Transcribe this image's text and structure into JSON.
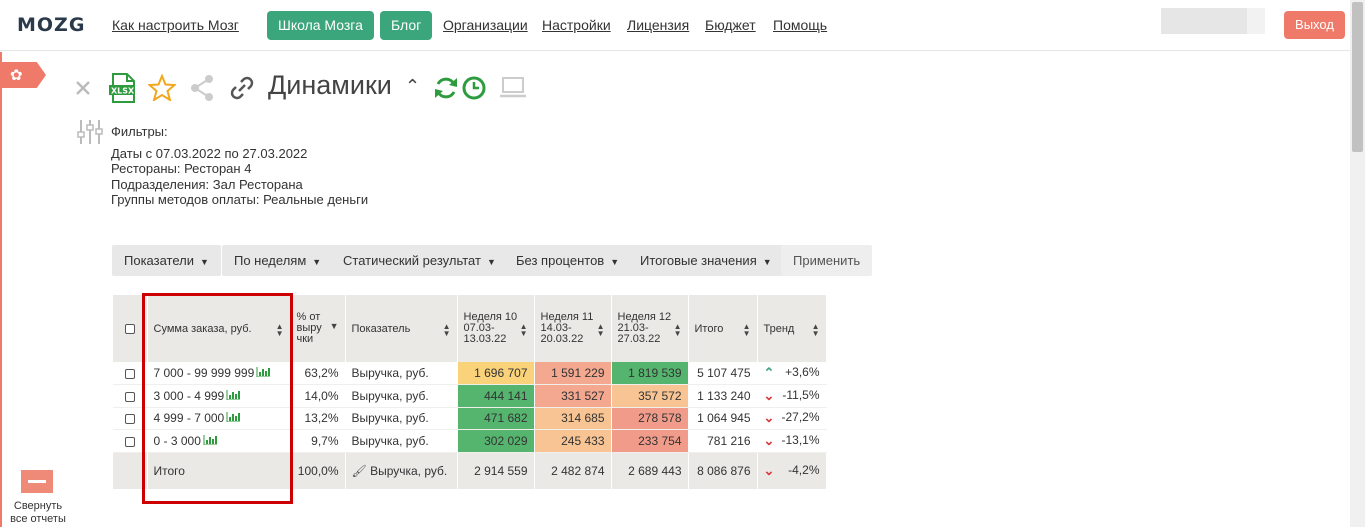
{
  "nav": {
    "logo": "MOZG",
    "links": [
      "Как настроить Мозг",
      "Организации",
      "Настройки",
      "Лицензия",
      "Бюджет",
      "Помощь"
    ],
    "school_btn": "Школа Мозга",
    "blog_btn": "Блог",
    "logout": "Выход"
  },
  "sidebar": {
    "collapse_label": "Свернуть все отчеты"
  },
  "report": {
    "title": "Динамики"
  },
  "filters": {
    "heading": "Фильтры:",
    "dates_label": "Даты",
    "dates_value": " с 07.03.2022 по 27.03.2022",
    "restaurants_label": "Рестораны:",
    "restaurants_value": " Ресторан 4",
    "departments_label": "Подразделения:",
    "departments_value": " Зал Ресторана",
    "payment_label": "Группы методов оплаты:",
    "payment_value": " Реальные деньги"
  },
  "toolbar": {
    "indicators": "Показатели",
    "by_weeks": "По неделям",
    "static_result": "Статический результат",
    "no_percent": "Без процентов",
    "totals": "Итоговые значения",
    "apply": "Применить"
  },
  "table": {
    "headers": {
      "order_sum": "Сумма заказа, руб.",
      "percent": "% от выру чки",
      "indicator": "Показатель",
      "week10": "Неделя 10 07.03-13.03.22",
      "week11": "Неделя 11 14.03-20.03.22",
      "week12": "Неделя 12 21.03-27.03.22",
      "total": "Итого",
      "trend": "Тренд"
    },
    "rows": [
      {
        "range": "7 000 - 99 999 999",
        "pct": "63,2%",
        "indicator": "Выручка, руб.",
        "w10": "1 696 707",
        "w11": "1 591 229",
        "w12": "1 819 539",
        "total": "5 107 475",
        "trend_dir": "up",
        "trend": "+3,6%"
      },
      {
        "range": "3 000 - 4 999",
        "pct": "14,0%",
        "indicator": "Выручка, руб.",
        "w10": "444 141",
        "w11": "331 527",
        "w12": "357 572",
        "total": "1 133 240",
        "trend_dir": "down",
        "trend": "-11,5%"
      },
      {
        "range": "4 999 - 7 000",
        "pct": "13,2%",
        "indicator": "Выручка, руб.",
        "w10": "471 682",
        "w11": "314 685",
        "w12": "278 578",
        "total": "1 064 945",
        "trend_dir": "down",
        "trend": "-27,2%"
      },
      {
        "range": "0 - 3 000",
        "pct": "9,7%",
        "indicator": "Выручка, руб.",
        "w10": "302 029",
        "w11": "245 433",
        "w12": "233 754",
        "total": "781 216",
        "trend_dir": "down",
        "trend": "-13,1%"
      }
    ],
    "total_row": {
      "label": "Итого",
      "pct": "100,0%",
      "indicator": "Выручка, руб.",
      "w10": "2 914 559",
      "w11": "2 482 874",
      "w12": "2 689 443",
      "total": "8 086 876",
      "trend": "-4,2%"
    }
  },
  "colors": {
    "green": "#55b56e",
    "light_red": "#f3a88f",
    "orange": "#f8c493",
    "yellow": "#f9d27a",
    "red": "#f19c8a"
  }
}
